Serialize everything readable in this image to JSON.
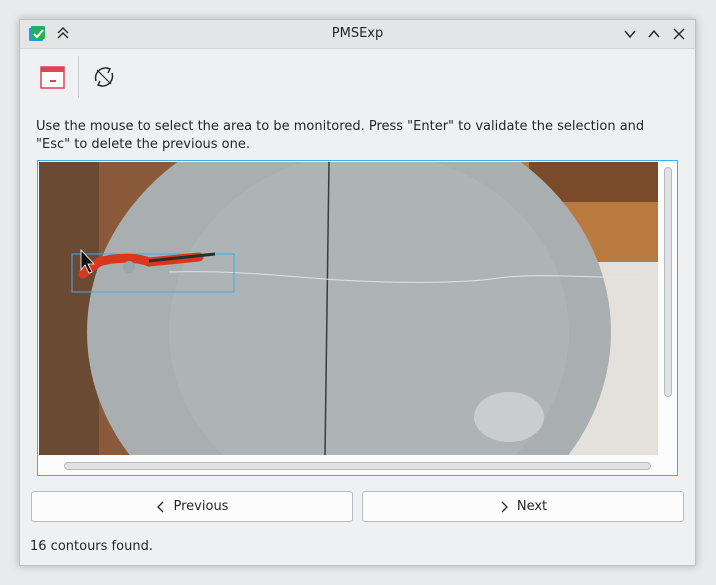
{
  "window": {
    "title": "PMSExp"
  },
  "instructions": "Use the mouse to select the area to be monitored. Press \"Enter\" to validate the selection and \"Esc\" to delete the previous one.",
  "buttons": {
    "previous": "Previous",
    "next": "Next"
  },
  "status": "16 contours found.",
  "colors": {
    "accent": "#3daee9",
    "calendar_icon": "#da4453"
  }
}
